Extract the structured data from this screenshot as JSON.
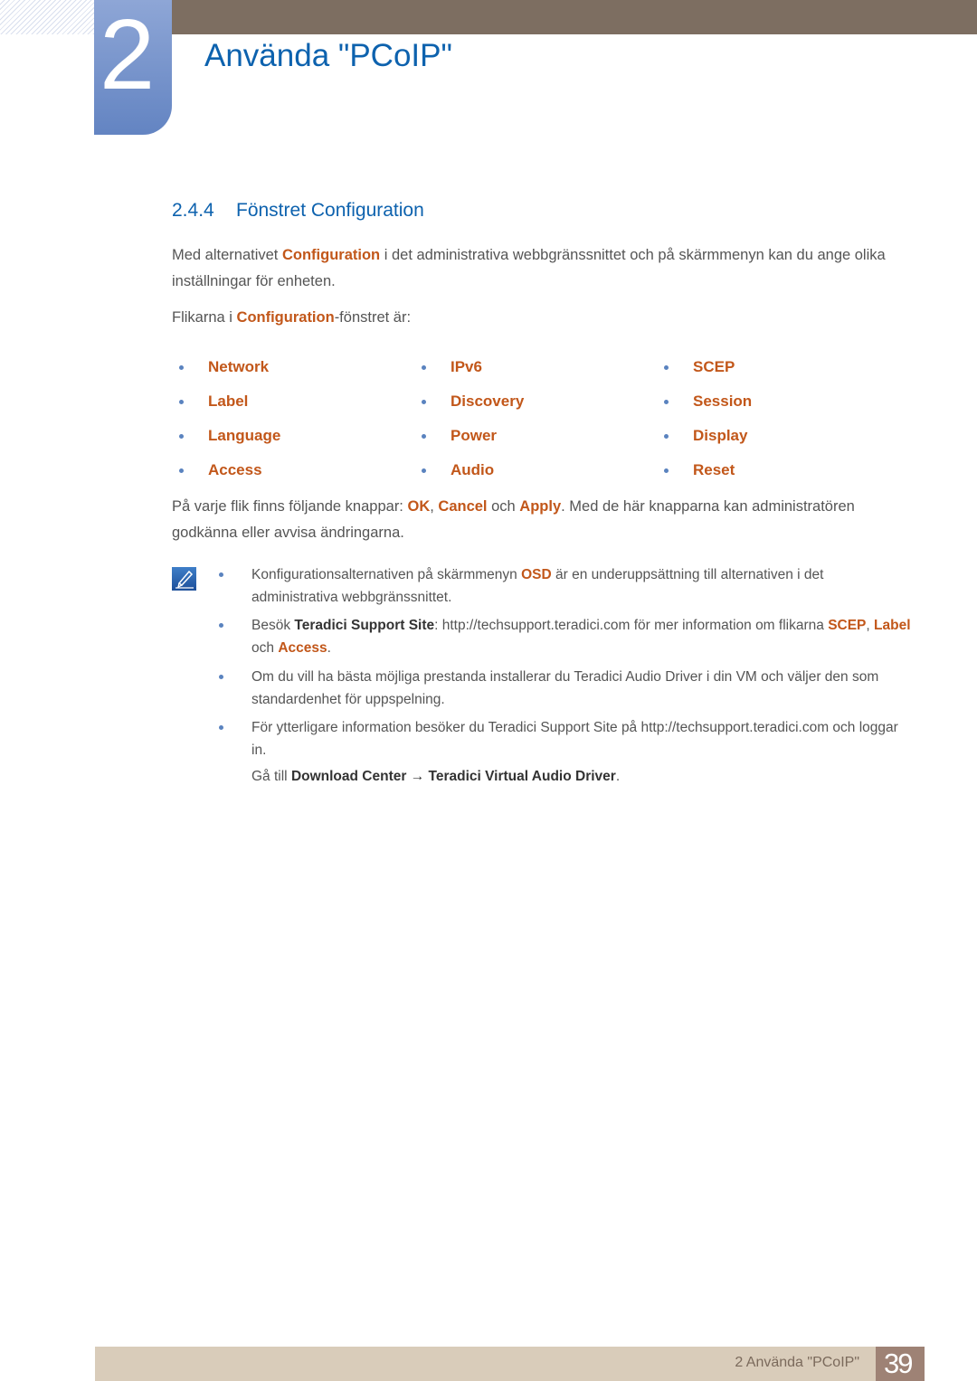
{
  "chapter": {
    "number": "2",
    "title": "Använda \"PCoIP\""
  },
  "section": {
    "number": "2.4.4",
    "title": "Fönstret Configuration"
  },
  "intro": {
    "p1_a": "Med alternativet ",
    "p1_hl": "Configuration",
    "p1_b": " i det administrativa webbgränssnittet och på skärmmenyn kan du ange olika inställningar för enheten.",
    "p2_a": "Flikarna i ",
    "p2_hl": "Configuration",
    "p2_b": "-fönstret är:"
  },
  "tabs": [
    [
      "Network",
      "Label",
      "Language",
      "Access"
    ],
    [
      "IPv6",
      "Discovery",
      "Power",
      "Audio"
    ],
    [
      "SCEP",
      "Session",
      "Display",
      "Reset"
    ]
  ],
  "buttons_para": {
    "a": "På varje flik finns följande knappar: ",
    "ok": "OK",
    "sep1": ", ",
    "cancel": "Cancel",
    "och": " och ",
    "apply": "Apply",
    "b": ". Med de här knapparna kan administratören godkänna eller avvisa ändringarna."
  },
  "notes": {
    "n1_a": "Konfigurationsalternativen på skärmmenyn ",
    "n1_hl": "OSD",
    "n1_b": " är en underuppsättning till alternativen i det administrativa webbgränssnittet.",
    "n2_a": "Besök ",
    "n2_bold": "Teradici Support Site",
    "n2_b": ": http://techsupport.teradici.com för mer information om flikarna ",
    "n2_scep": "SCEP",
    "n2_sep": ", ",
    "n2_label": "Label",
    "n2_och": " och ",
    "n2_access": "Access",
    "n2_end": ".",
    "n3": "Om du vill ha bästa möjliga prestanda installerar du Teradici Audio Driver i din VM och väljer den som standardenhet för uppspelning.",
    "n4": "För ytterligare information besöker du Teradici Support Site på http://techsupport.teradici.com och loggar in.",
    "n5_a": "Gå till ",
    "n5_b1": "Download Center",
    "n5_arrow": " → ",
    "n5_b2": "Teradici Virtual Audio Driver",
    "n5_end": "."
  },
  "footer": {
    "title": "2 Använda \"PCoIP\"",
    "page": "39"
  }
}
